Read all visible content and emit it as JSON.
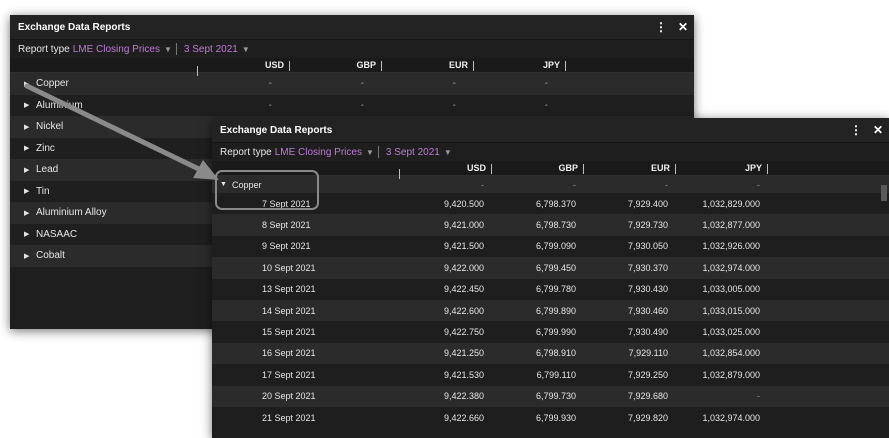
{
  "back_panel": {
    "title": "Exchange Data Reports",
    "menu_glyph": "⋮",
    "close_glyph": "✕",
    "report_type_label": "Report type",
    "report_type_value": "LME Closing Prices",
    "date_value": "3 Sept 2021",
    "columns": [
      "USD",
      "GBP",
      "EUR",
      "JPY"
    ],
    "rows": [
      {
        "name": "Copper",
        "values": [
          "-",
          "-",
          "-",
          "-"
        ]
      },
      {
        "name": "Aluminium",
        "values": [
          "-",
          "-",
          "-",
          "-"
        ]
      },
      {
        "name": "Nickel",
        "values": [
          "",
          "",
          "",
          ""
        ]
      },
      {
        "name": "Zinc",
        "values": [
          "",
          "",
          "",
          ""
        ]
      },
      {
        "name": "Lead",
        "values": [
          "",
          "",
          "",
          ""
        ]
      },
      {
        "name": "Tin",
        "values": [
          "",
          "",
          "",
          ""
        ]
      },
      {
        "name": "Aluminium Alloy",
        "values": [
          "",
          "",
          "",
          ""
        ]
      },
      {
        "name": "NASAAC",
        "values": [
          "",
          "",
          "",
          ""
        ]
      },
      {
        "name": "Cobalt",
        "values": [
          "",
          "",
          "",
          ""
        ]
      }
    ]
  },
  "front_panel": {
    "title": "Exchange Data Reports",
    "menu_glyph": "⋮",
    "close_glyph": "✕",
    "report_type_label": "Report type",
    "report_type_value": "LME Closing Prices",
    "date_value": "3 Sept 2021",
    "columns": [
      "USD",
      "GBP",
      "EUR",
      "JPY"
    ],
    "parent_row": {
      "name": "Copper",
      "values": [
        "-",
        "-",
        "-",
        "-"
      ]
    },
    "rows": [
      {
        "date": "7 Sept 2021",
        "values": [
          "9,420.500",
          "6,798.370",
          "7,929.400",
          "1,032,829.000"
        ]
      },
      {
        "date": "8 Sept 2021",
        "values": [
          "9,421.000",
          "6,798.730",
          "7,929.730",
          "1,032,877.000"
        ]
      },
      {
        "date": "9 Sept 2021",
        "values": [
          "9,421.500",
          "6,799.090",
          "7,930.050",
          "1,032,926.000"
        ]
      },
      {
        "date": "10 Sept 2021",
        "values": [
          "9,422.000",
          "6,799.450",
          "7,930.370",
          "1,032,974.000"
        ]
      },
      {
        "date": "13 Sept 2021",
        "values": [
          "9,422.450",
          "6,799.780",
          "7,930.430",
          "1,033,005.000"
        ]
      },
      {
        "date": "14 Sept 2021",
        "values": [
          "9,422.600",
          "6,799.890",
          "7,930.460",
          "1,033,015.000"
        ]
      },
      {
        "date": "15 Sept 2021",
        "values": [
          "9,422.750",
          "6,799.990",
          "7,930.490",
          "1,033,025.000"
        ]
      },
      {
        "date": "16 Sept 2021",
        "values": [
          "9,421.250",
          "6,798.910",
          "7,929.110",
          "1,032,854.000"
        ]
      },
      {
        "date": "17 Sept 2021",
        "values": [
          "9,421.530",
          "6,799.110",
          "7,929.250",
          "1,032,879.000"
        ]
      },
      {
        "date": "20 Sept 2021",
        "values": [
          "9,422.380",
          "6,799.730",
          "7,929.680",
          "-"
        ]
      },
      {
        "date": "21 Sept 2021",
        "values": [
          "9,422.660",
          "6,799.930",
          "7,929.820",
          "1,032,974.000"
        ]
      }
    ]
  },
  "colors": {
    "accent_purple": "#c07ad6",
    "panel_bg": "#1e1e1e",
    "row_alt": "#2b2b2b",
    "annotation_gray": "#8a8a8a"
  }
}
